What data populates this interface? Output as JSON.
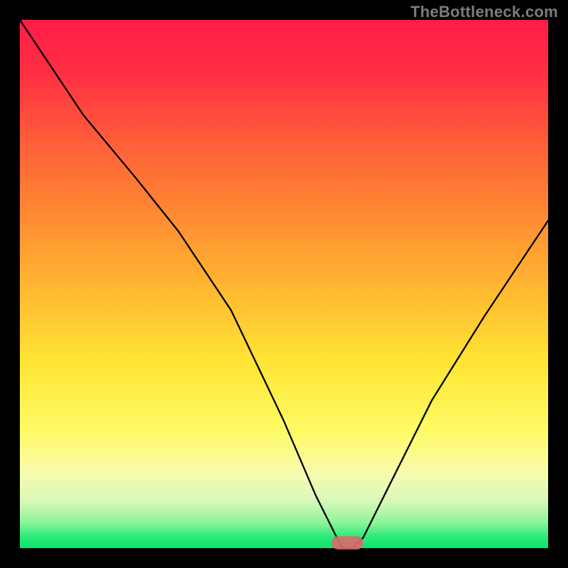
{
  "watermark": "TheBottleneck.com",
  "colors": {
    "frame": "#000000",
    "gradient_top": "#ff1c49",
    "gradient_mid": "#ffe534",
    "gradient_bottom": "#0ae46d",
    "curve": "#000000",
    "marker": "#d86b6b"
  },
  "chart_data": {
    "type": "line",
    "title": "",
    "xlabel": "",
    "ylabel": "",
    "xlim": [
      0,
      100
    ],
    "ylim": [
      0,
      100
    ],
    "grid": false,
    "series": [
      {
        "name": "bottleneck-curve",
        "x": [
          0,
          12,
          22,
          30,
          40,
          50,
          56,
          60,
          61,
          63,
          65,
          70,
          78,
          88,
          100
        ],
        "values": [
          100,
          82,
          70,
          60,
          45,
          24,
          10,
          2,
          0,
          0,
          2,
          12,
          28,
          44,
          62
        ]
      }
    ],
    "annotations": [
      {
        "name": "optimal-marker",
        "shape": "capsule",
        "x_center": 62,
        "y_center": 1,
        "width": 6,
        "height": 2.5
      }
    ]
  }
}
